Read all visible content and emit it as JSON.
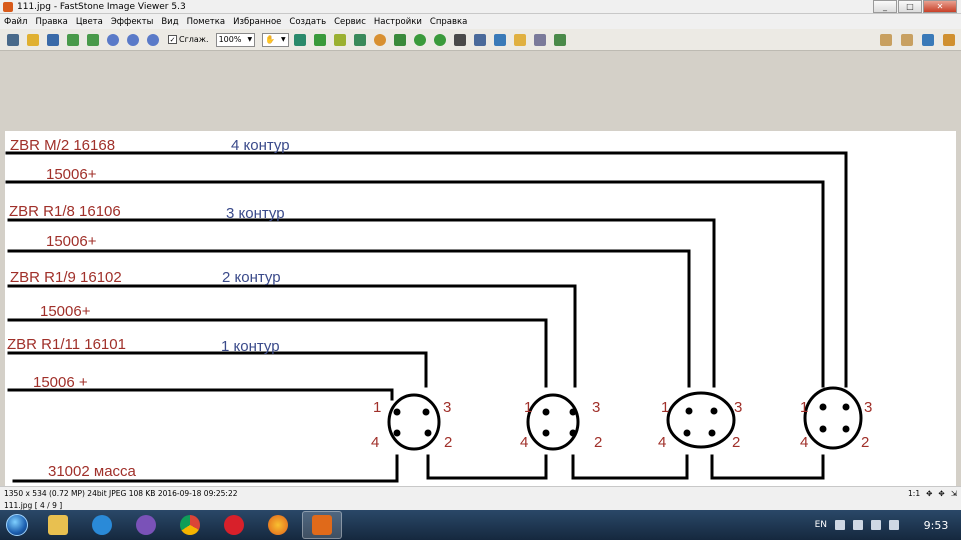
{
  "window": {
    "title": "111.jpg  -  FastStone Image Viewer 5.3",
    "minimize": "_",
    "maximize": "□",
    "close": "✕"
  },
  "menu": [
    "Файл",
    "Правка",
    "Цвета",
    "Эффекты",
    "Вид",
    "Пометка",
    "Избранное",
    "Создать",
    "Сервис",
    "Настройки",
    "Справка"
  ],
  "toolbar": {
    "smooth_checkbox": "✓",
    "smooth_label": "Сглаж.",
    "zoom_value": "100%"
  },
  "diagram": {
    "labels": [
      {
        "text": "ZBR M/2  16168",
        "color": "#a0302a"
      },
      {
        "text": "4 контур",
        "color": "#3a4a8a"
      },
      {
        "text": "15006+",
        "color": "#a0302a"
      },
      {
        "text": "ZBR R1/8  16106",
        "color": "#a0302a"
      },
      {
        "text": "3 контур",
        "color": "#3a4a8a"
      },
      {
        "text": "15006+",
        "color": "#a0302a"
      },
      {
        "text": "ZBR R1/9  16102",
        "color": "#a0302a"
      },
      {
        "text": "2 контур",
        "color": "#3a4a8a"
      },
      {
        "text": "15006+",
        "color": "#a0302a"
      },
      {
        "text": "ZBR  R1/11  16101",
        "color": "#a0302a"
      },
      {
        "text": "1 контур",
        "color": "#3a4a8a"
      },
      {
        "text": "15006 +",
        "color": "#a0302a"
      },
      {
        "text": "31002 масса",
        "color": "#a0302a"
      }
    ],
    "pin_labels": [
      "1",
      "3",
      "4",
      "2"
    ]
  },
  "status": {
    "info": "1350 x 534 (0.72 MP)  24bit  JPEG   108 KB   2016-09-18 09:25:22",
    "file": "111.jpg [ 4 / 9 ]",
    "ratio": "1:1"
  },
  "taskbar": {
    "lang": "EN",
    "clock": "9:53"
  }
}
